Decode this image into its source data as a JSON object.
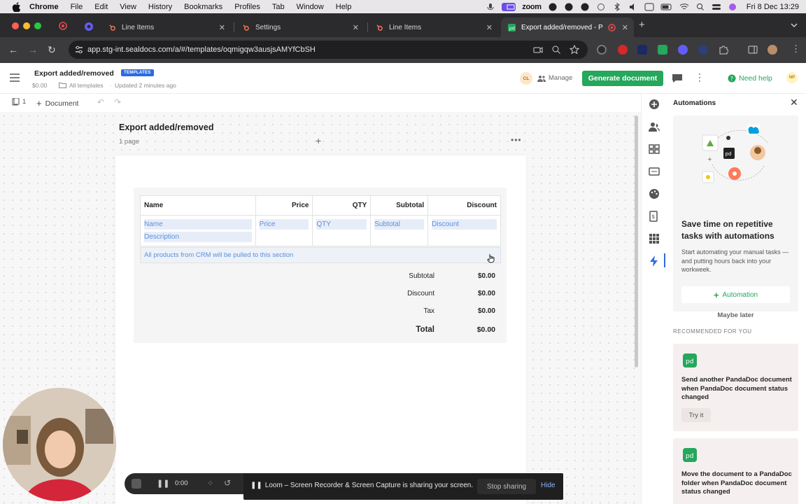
{
  "macbar": {
    "app": "Chrome",
    "menus": [
      "File",
      "Edit",
      "View",
      "History",
      "Bookmarks",
      "Profiles",
      "Tab",
      "Window",
      "Help"
    ],
    "zoom_label": "zoom",
    "clock": "Fri 8 Dec  13:29"
  },
  "tabs": [
    {
      "label": "Line Items",
      "icon": "hubspot-icon"
    },
    {
      "label": "Settings",
      "icon": "hubspot-icon"
    },
    {
      "label": "Line Items",
      "icon": "hubspot-icon"
    },
    {
      "label": "Export added/removed - P",
      "icon": "pandadoc-icon"
    }
  ],
  "address": {
    "url": "app.stg-int.sealdocs.com/a/#/templates/oqmigqw3ausjsAMYfCbSH"
  },
  "header": {
    "title": "Export added/removed",
    "badge": "TEMPLATES",
    "amount": "$0.00",
    "folder": "All templates",
    "updated": "Updated 2 minutes ago",
    "avatar_initials": "CL",
    "manage_label": "Manage",
    "generate_label": "Generate document",
    "help_label": "Need help",
    "user_initials": "NP"
  },
  "subbar": {
    "page_count": "1",
    "add_label": "Document"
  },
  "canvas": {
    "title": "Export added/removed",
    "pages": "1 page",
    "table": {
      "headers": [
        "Name",
        "Price",
        "QTY",
        "Subtotal",
        "Discount"
      ],
      "row": [
        "Name",
        "Price",
        "QTY",
        "Subtotal",
        "Discount"
      ],
      "row_description": "Description",
      "crm_note": "All products from CRM will be pulled to this section"
    },
    "totals": [
      {
        "label": "Subtotal",
        "value": "$0.00"
      },
      {
        "label": "Discount",
        "value": "$0.00"
      },
      {
        "label": "Tax",
        "value": "$0.00"
      },
      {
        "label": "Total",
        "value": "$0.00"
      }
    ]
  },
  "panel": {
    "title": "Automations",
    "promo_title": "Save time on repetitive tasks with automations",
    "promo_desc": "Start automating your manual tasks — and putting hours back into your workweek.",
    "automation_button": "Automation",
    "maybe_later": "Maybe later",
    "recommended_heading": "RECOMMENDED FOR YOU",
    "cards": [
      {
        "text": "Send another PandaDoc document when PandaDoc document status changed",
        "button": "Try it"
      },
      {
        "text": "Move the document to a PandaDoc folder when PandaDoc document status changed"
      }
    ]
  },
  "loom": {
    "time": "0:00",
    "sharing_text": "Loom – Screen Recorder & Screen Capture is sharing your screen.",
    "stop_label": "Stop sharing",
    "hide_label": "Hide"
  },
  "colors": {
    "accent_green": "#25a75c",
    "link_blue": "#5a8fe0",
    "badge_blue": "#2d6cdf"
  }
}
